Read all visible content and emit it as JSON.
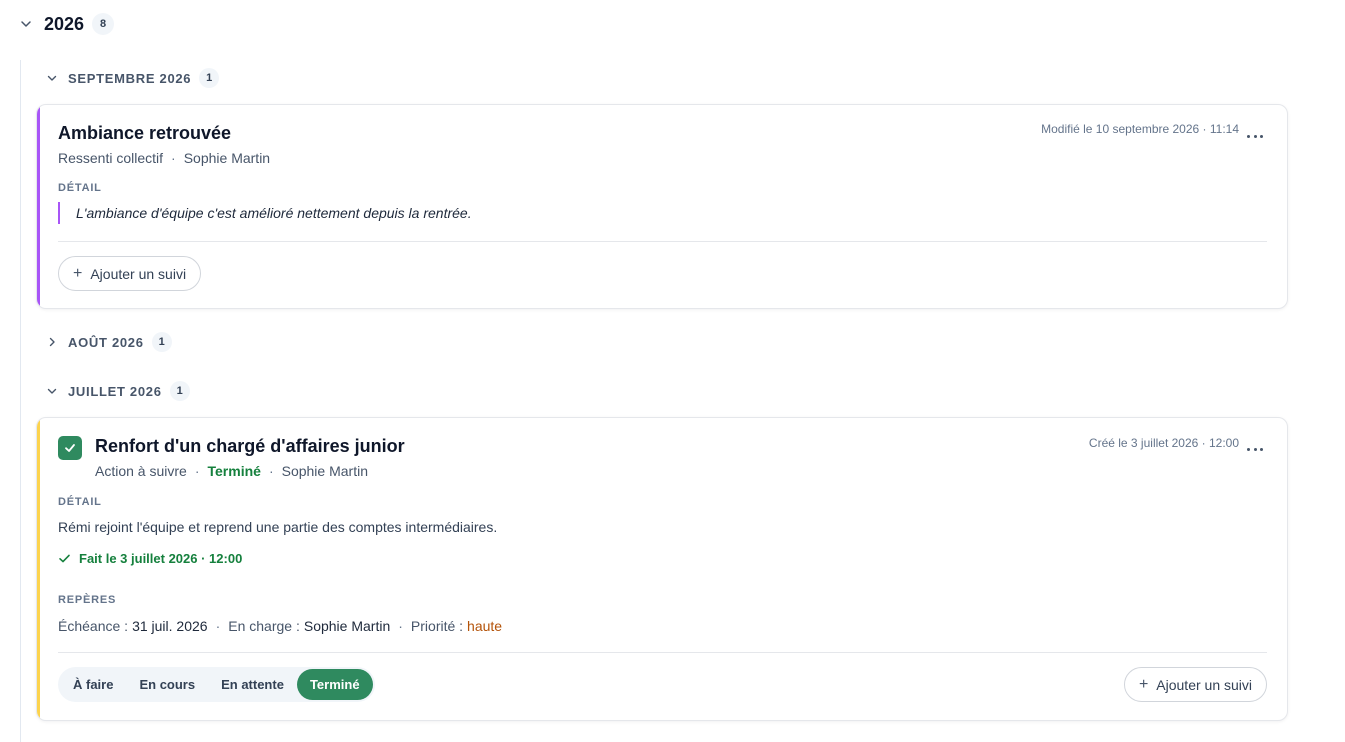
{
  "year": {
    "label": "2026",
    "count": "8"
  },
  "months": {
    "september": {
      "label": "SEPTEMBRE 2026",
      "count": "1",
      "expanded": true
    },
    "august": {
      "label": "AOÛT 2026",
      "count": "1",
      "expanded": false
    },
    "july": {
      "label": "JUILLET 2026",
      "count": "1",
      "expanded": true
    }
  },
  "card1": {
    "accent_color": "#a855f7",
    "title": "Ambiance retrouvée",
    "type": "Ressenti collectif",
    "author": "Sophie Martin",
    "stamp": "Modifié le 10 septembre 2026 · 11:14",
    "detail_label": "DÉTAIL",
    "detail_quote": "L'ambiance d'équipe c'est amélioré nettement depuis la rentrée.",
    "add_followup": "Ajouter un suivi"
  },
  "card2": {
    "accent_color": "#fcd34d",
    "title": "Renfort d'un chargé d'affaires junior",
    "type": "Action à suivre",
    "status": "Terminé",
    "author": "Sophie Martin",
    "stamp": "Créé le 3 juillet 2026 · 12:00",
    "detail_label": "DÉTAIL",
    "detail_text": "Rémi rejoint l'équipe et reprend une partie des comptes intermédiaires.",
    "done_text": "Fait le 3 juillet 2026 · 12:00",
    "reperes_label": "REPÈRES",
    "due_label": "Échéance :",
    "due_value": "31 juil. 2026",
    "owner_label": "En charge :",
    "owner_value": "Sophie Martin",
    "priority_label": "Priorité :",
    "priority_value": "haute",
    "status_options": [
      "À faire",
      "En cours",
      "En attente",
      "Terminé"
    ],
    "active_status": "Terminé",
    "add_followup": "Ajouter un suivi"
  },
  "colors": {
    "success_green": "#2f8a5f",
    "priority_amber": "#b45309"
  }
}
